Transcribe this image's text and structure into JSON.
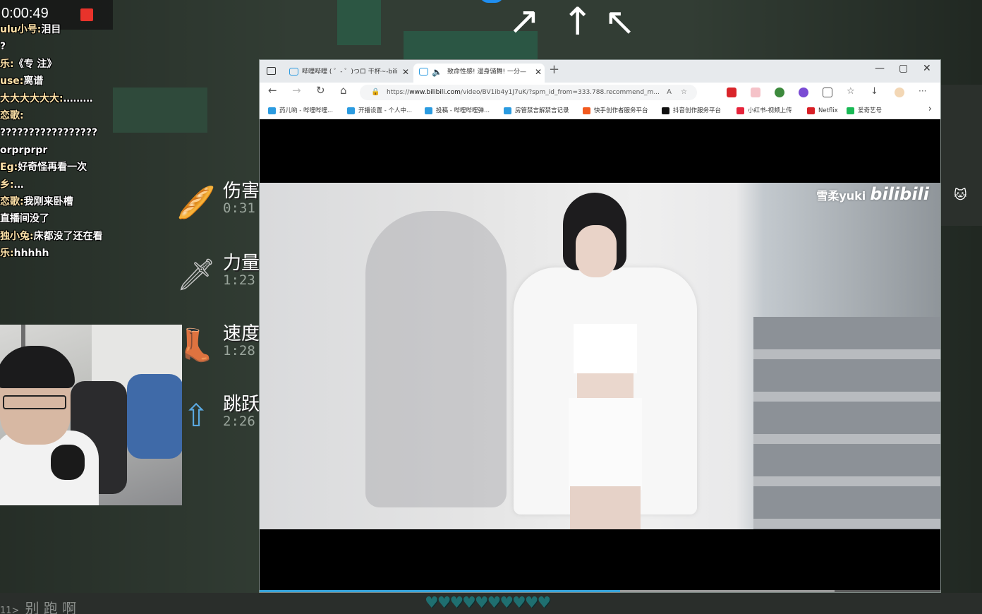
{
  "recorder": {
    "time": "0:00:49"
  },
  "chat": [
    {
      "nick": "ulu小号:",
      "text": "泪目"
    },
    {
      "nick": "",
      "text": "?"
    },
    {
      "nick": "乐:",
      "text": "《专 注》"
    },
    {
      "nick": "use:",
      "text": "离谱"
    },
    {
      "nick": "大大大大大大:",
      "text": "………"
    },
    {
      "nick": "恋歌:",
      "text": ""
    },
    {
      "nick": "",
      "text": "?????????????????"
    },
    {
      "nick": "",
      "text": "orprprpr"
    },
    {
      "nick": "Eg:",
      "text": "好奇怪再看一次"
    },
    {
      "nick": "乡:",
      "text": "…"
    },
    {
      "nick": "恋歌:",
      "text": "我刚来卧槽"
    },
    {
      "nick": "",
      "text": "直播间没了"
    },
    {
      "nick": "独小兔:",
      "text": "床都没了还在看"
    },
    {
      "nick": "乐:",
      "text": "hhhhh"
    }
  ],
  "effects": [
    {
      "name": "伤害",
      "time": "0:31",
      "icon": "bread-icon",
      "glyph": "🥖"
    },
    {
      "name": "力量",
      "time": "1:23",
      "icon": "sword-icon",
      "glyph": "🗡"
    },
    {
      "name": "速度",
      "time": "1:28",
      "icon": "boot-icon",
      "glyph": "👢"
    },
    {
      "name": "跳跃",
      "time": "2:26",
      "icon": "jump-arrow-icon",
      "glyph": "⇧"
    }
  ],
  "arrows": {
    "left": "↖",
    "up": "↑",
    "right": "↖"
  },
  "browser": {
    "tabs": [
      {
        "title": "哔哩哔哩 ( ゜- ゜)つロ 干杯~-bili",
        "active": false
      },
      {
        "title": "致命性感! 湿身骑舞! 一分—",
        "active": true
      }
    ],
    "new_tab": "+",
    "window_controls": {
      "minimize": "—",
      "maximize": "▢",
      "close": "✕"
    },
    "nav": {
      "back": "←",
      "forward": "→",
      "reload": "↻",
      "home": "⌂"
    },
    "address": {
      "prefix": "https://",
      "host": "www.bilibili.com",
      "path": "/video/BV1ib4y1J7uK/?spm_id_from=333.788.recommend_m..."
    },
    "address_icons": {
      "read_aloud": "A",
      "favorite": "☆"
    },
    "toolbar_icons": {
      "favorites": "☆",
      "downloads": "↓",
      "more": "···"
    },
    "bookmarks": [
      {
        "label": "药儿哟 - 哔哩哔哩...",
        "color": "#2b9be0"
      },
      {
        "label": "开播设置 - 个人中...",
        "color": "#2b9be0"
      },
      {
        "label": "投稿 - 哔哩哔哩弹...",
        "color": "#2b9be0"
      },
      {
        "label": "房管禁言解禁言记录",
        "color": "#2b9be0"
      },
      {
        "label": "快手创作者服务平台",
        "color": "#f25a1f"
      },
      {
        "label": "抖音创作服务平台",
        "color": "#111111"
      },
      {
        "label": "小红书-视频上传",
        "color": "#e6243b"
      },
      {
        "label": "Netflix",
        "color": "#d81f26"
      },
      {
        "label": "爱奇艺号",
        "color": "#19b955"
      }
    ],
    "bookmarks_more": "›",
    "video": {
      "watermark_user": "雪柔yuki",
      "watermark_brand": "bilibili",
      "progress": 0.53,
      "buffered": 0.845
    }
  },
  "bottom": {
    "index": "11>",
    "text": "别 跑 啊"
  },
  "hearts": "♥♥♥♥♥♥♥♥♥♥"
}
